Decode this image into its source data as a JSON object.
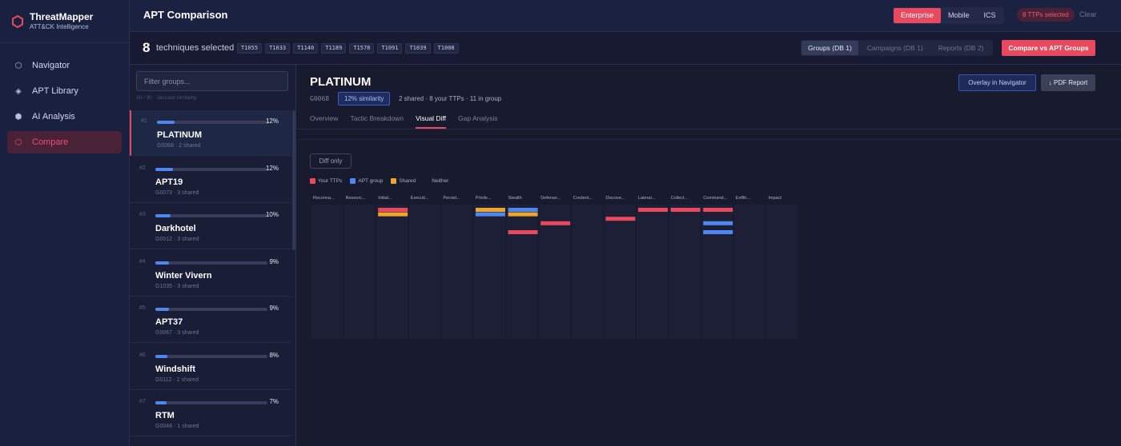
{
  "brand": {
    "title": "ThreatMapper",
    "subtitle": "ATT&CK Intelligence",
    "logo_icon": "hexagon-logo-icon",
    "accent": "#e8495f"
  },
  "nav": {
    "items": [
      {
        "label": "Navigator",
        "icon": "hexagon-outline-icon",
        "active": false
      },
      {
        "label": "APT Library",
        "icon": "diamond-icon",
        "active": false
      },
      {
        "label": "AI Analysis",
        "icon": "hexagon-filled-icon",
        "active": false
      },
      {
        "label": "Compare",
        "icon": "hexagon-outline-icon",
        "active": true
      }
    ]
  },
  "header": {
    "title": "APT Comparison",
    "domains": [
      "Enterprise",
      "Mobile",
      "ICS"
    ],
    "active_domain": "Enterprise",
    "ttp_badge": "8 TTPs selected",
    "clear": "Clear"
  },
  "techbar": {
    "count": "8",
    "count_label": "techniques selected",
    "chips": [
      "T1055",
      "T1033",
      "T1140",
      "T1189",
      "T1578",
      "T1091",
      "T1039",
      "T1008"
    ],
    "db_tabs": [
      "Groups (DB 1)",
      "Campaigns (DB 1)",
      "Reports (DB 2)"
    ],
    "active_db_tab": "Groups (DB 1)",
    "compare_button": "Compare vs APT Groups"
  },
  "grouplist": {
    "placeholder": "Filter groups...",
    "meta": "30 / 30 · Jaccard similarity",
    "groups": [
      {
        "rank": "#1",
        "name": "PLATINUM",
        "sub": "G0068 · 2 shared",
        "pct": "12%",
        "fill": 0.12,
        "active": true
      },
      {
        "rank": "#2",
        "name": "APT19",
        "sub": "G0073 · 3 shared",
        "pct": "12%",
        "fill": 0.12
      },
      {
        "rank": "#3",
        "name": "Darkhotel",
        "sub": "G0012 · 3 shared",
        "pct": "10%",
        "fill": 0.1
      },
      {
        "rank": "#4",
        "name": "Winter Vivern",
        "sub": "G1035 · 3 shared",
        "pct": "9%",
        "fill": 0.09
      },
      {
        "rank": "#5",
        "name": "APT37",
        "sub": "G0067 · 3 shared",
        "pct": "9%",
        "fill": 0.09
      },
      {
        "rank": "#6",
        "name": "Windshift",
        "sub": "G0112 · 2 shared",
        "pct": "8%",
        "fill": 0.08
      },
      {
        "rank": "#7",
        "name": "RTM",
        "sub": "G0048 · 1 shared",
        "pct": "7%",
        "fill": 0.07
      }
    ]
  },
  "detail": {
    "name": "PLATINUM",
    "id": "G0068",
    "similarity": "12% similarity",
    "stats": "2 shared · 8 your TTPs · 11 in group",
    "overlay_button": "Overlay in Navigator",
    "pdf_button": "↓ PDF Report",
    "tabs": [
      "Overview",
      "Tactic Breakdown",
      "Visual Diff",
      "Gap Analysis"
    ],
    "active_tab": "Visual Diff",
    "diff_toggle": "Diff only",
    "legend": [
      {
        "label": "Your TTPs",
        "color": "#e8495f"
      },
      {
        "label": "APT group",
        "color": "#4f87f0"
      },
      {
        "label": "Shared",
        "color": "#f0a528"
      },
      {
        "label": "Neither",
        "color": "#181a2e"
      }
    ],
    "tactics": [
      {
        "label": "Reconna...",
        "cells": []
      },
      {
        "label": "Resourc...",
        "cells": []
      },
      {
        "label": "Initial...",
        "cells": [
          "your",
          "shared"
        ]
      },
      {
        "label": "Executi...",
        "cells": []
      },
      {
        "label": "Persist...",
        "cells": []
      },
      {
        "label": "Privile...",
        "cells": [
          "shared",
          "apt"
        ]
      },
      {
        "label": "Stealth",
        "cells": [
          "apt",
          "shared",
          "",
          "",
          "",
          "your"
        ]
      },
      {
        "label": "Defense...",
        "cells": [
          "",
          "",
          "",
          "your"
        ]
      },
      {
        "label": "Credent...",
        "cells": []
      },
      {
        "label": "Discove...",
        "cells": [
          "",
          "",
          "your"
        ]
      },
      {
        "label": "Lateral...",
        "cells": [
          "your"
        ]
      },
      {
        "label": "Collect...",
        "cells": [
          "your"
        ]
      },
      {
        "label": "Command...",
        "cells": [
          "your",
          "",
          "",
          "apt",
          "",
          "apt"
        ]
      },
      {
        "label": "Exfiltr...",
        "cells": []
      },
      {
        "label": "Impact",
        "cells": []
      }
    ]
  }
}
